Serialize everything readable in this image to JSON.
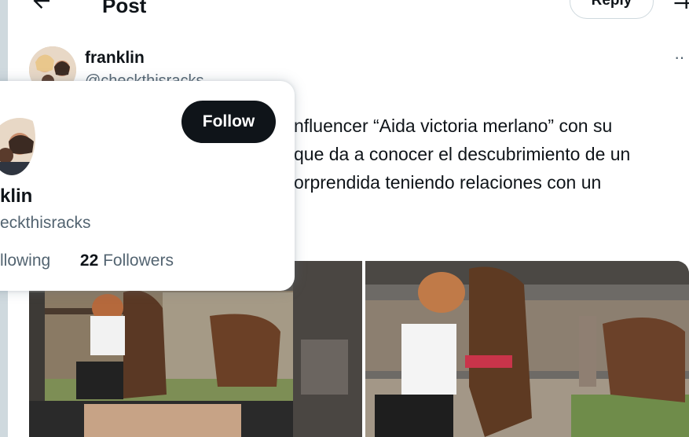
{
  "header": {
    "title": "Post",
    "reply_label": "Reply",
    "icons": {
      "back": "arrow-left-icon",
      "extend": "extend-icon"
    }
  },
  "post": {
    "author_name": "franklin",
    "author_handle": "@checkthisracks",
    "text_lines": [
      "nfluencer “Aida victoria merlano” con su",
      "que da a conocer el descubrimiento de un",
      "orprendida teniendo relaciones con un"
    ],
    "more_icon": "more-horizontal-icon"
  },
  "hover_card": {
    "follow_label": "Follow",
    "name": "klin",
    "handle": "eckthisracks",
    "following_text": "llowing",
    "followers_count": "22",
    "followers_label": "Followers"
  },
  "colors": {
    "text_primary": "#0f1419",
    "text_secondary": "#536471",
    "follow_bg": "#0f1419",
    "border": "#cfd9de"
  }
}
